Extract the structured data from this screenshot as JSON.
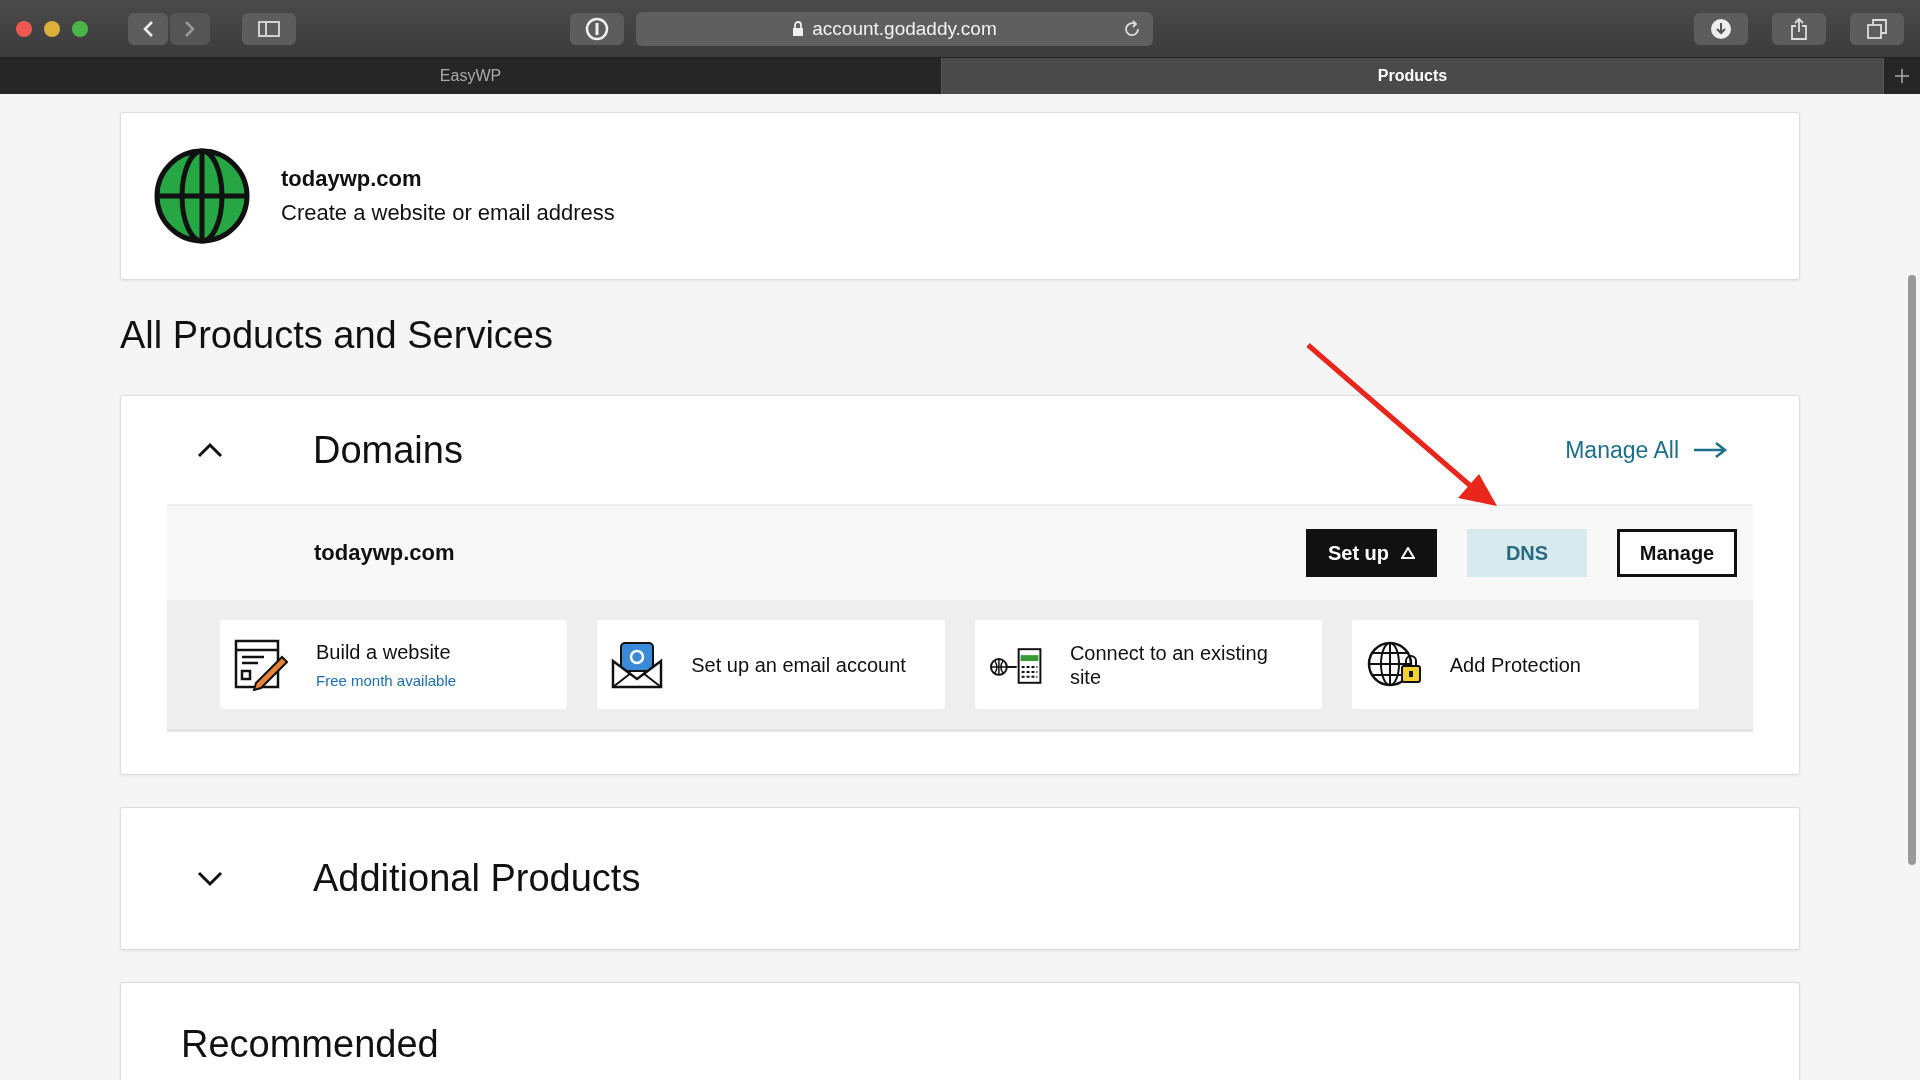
{
  "browser": {
    "address": "account.godaddy.com",
    "tabs": [
      {
        "label": "EasyWP",
        "selected": false
      },
      {
        "label": "Products",
        "selected": true
      }
    ]
  },
  "domain_card": {
    "name": "todaywp.com",
    "subtitle": "Create a website or email address"
  },
  "heading": "All Products and Services",
  "sections": [
    {
      "title": "Domains",
      "expanded": true,
      "manage_all": "Manage All",
      "domain": {
        "name": "todaywp.com",
        "buttons": [
          {
            "label": "Set up",
            "kind": "dark"
          },
          {
            "label": "DNS",
            "kind": "hovered"
          },
          {
            "label": "Manage",
            "kind": "outline"
          }
        ]
      },
      "actions": [
        {
          "kind": "website",
          "title": "Build a website",
          "note": "Free month available"
        },
        {
          "kind": "email",
          "title": "Set up an email account"
        },
        {
          "kind": "connect",
          "title": "Connect to an existing site"
        },
        {
          "kind": "protection",
          "title": "Add Protection"
        }
      ]
    },
    {
      "title": "Additional Products",
      "expanded": false
    }
  ],
  "recommended": {
    "title": "Recommended"
  }
}
